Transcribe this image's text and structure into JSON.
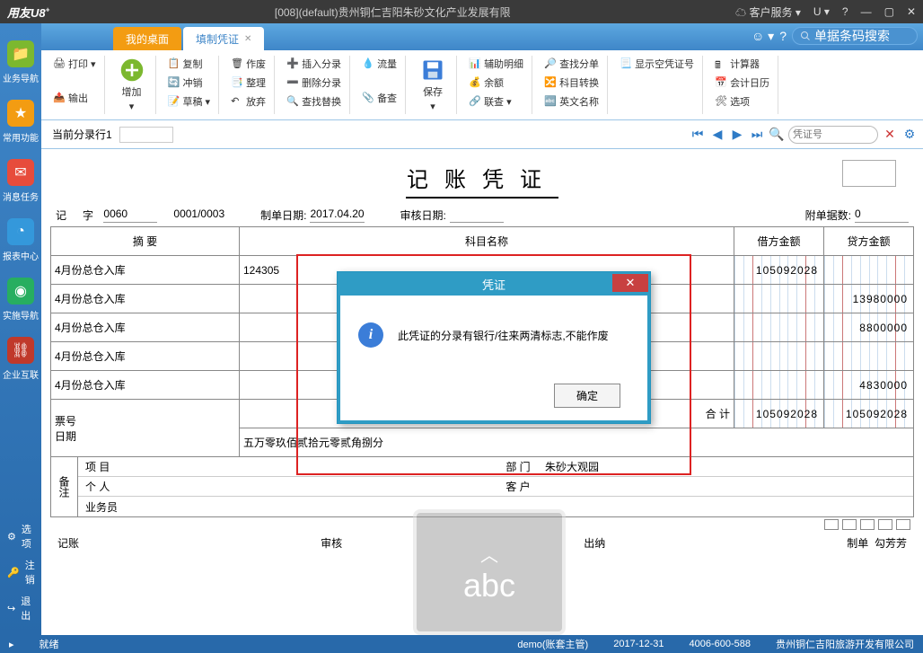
{
  "titlebar": {
    "logo": "用友",
    "logo_suffix": "U8",
    "logo_sup": "+",
    "title": "[008](default)贵州铜仁吉阳朱砂文化产业发展有限",
    "customer_service": "客户服务",
    "u": "U"
  },
  "tabs": {
    "desktop": "我的桌面",
    "voucher": "填制凭证"
  },
  "search": {
    "placeholder": "单据条码搜索"
  },
  "toolbar": {
    "print": "打印",
    "output": "输出",
    "add": "增加",
    "copy": "复制",
    "reverse": "冲销",
    "draft": "草稿",
    "void": "作废",
    "tidy": "整理",
    "abandon": "放弃",
    "insert_line": "插入分录",
    "delete_line": "删除分录",
    "find_replace": "查找替换",
    "flow": "流量",
    "backup": "备查",
    "save": "保存",
    "aux_detail": "辅助明细",
    "balance": "余额",
    "linked": "联查",
    "find_doc": "查找分单",
    "acct_switch": "科目转换",
    "eng_name": "英文名称",
    "show_empty": "显示空凭证号",
    "calc": "计算器",
    "calendar": "会计日历",
    "options": "选项"
  },
  "subheader": {
    "cur_line": "当前分录行1"
  },
  "nav_search": {
    "placeholder": "凭证号"
  },
  "doc": {
    "title": "记账凭证",
    "type": "记",
    "zi": "字",
    "no": "0060",
    "seq": "0001/0003",
    "make_date_label": "制单日期:",
    "make_date": "2017.04.20",
    "audit_date_label": "审核日期:",
    "audit_date": "",
    "attach_label": "附单据数:",
    "attach": "0",
    "hdr_summary": "摘 要",
    "hdr_account": "科目名称",
    "hdr_debit": "借方金额",
    "hdr_credit": "贷方金额",
    "rows": [
      {
        "summary": "4月份总仓入库",
        "account": "124305",
        "debit": "105092028",
        "credit": ""
      },
      {
        "summary": "4月份总仓入库",
        "account": "",
        "debit": "",
        "credit": "13980000"
      },
      {
        "summary": "4月份总仓入库",
        "account": "",
        "debit": "",
        "credit": "8800000"
      },
      {
        "summary": "4月份总仓入库",
        "account": "",
        "debit": "",
        "credit": ""
      },
      {
        "summary": "4月份总仓入库",
        "account": "",
        "debit": "",
        "credit": "4830000"
      }
    ],
    "total_label": "合 计",
    "total_debit": "105092028",
    "total_credit": "105092028",
    "ticket_no": "票号",
    "date": "日期",
    "chinese_amt": "五万零玖佰贰拾元零贰角捌分",
    "remark": "备注",
    "project": "项 目",
    "person": "个 人",
    "salesman": "业务员",
    "dept": "部 门",
    "dept_val": "朱砂大观园",
    "customer": "客 户",
    "sig_bookkeeper": "记账",
    "sig_audit": "审核",
    "sig_cashier": "出纳",
    "sig_maker": "制单",
    "sig_maker_val": "勾芳芳"
  },
  "modal": {
    "title": "凭证",
    "message": "此凭证的分录有银行/往来两清标志,不能作废",
    "ok": "确定"
  },
  "left_sidebar": {
    "biz_nav": "业务导航",
    "common": "常用功能",
    "msg_task": "消息任务",
    "report": "报表中心",
    "impl": "实施导航",
    "ent": "企业互联",
    "options": "选项",
    "logout": "注销",
    "exit": "退出"
  },
  "statusbar": {
    "ready": "就绪",
    "user": "demo(账套主管)",
    "date": "2017-12-31",
    "phone": "4006-600-588",
    "company": "贵州铜仁吉阳旅游开发有限公司"
  },
  "ime": {
    "text": "abc"
  }
}
